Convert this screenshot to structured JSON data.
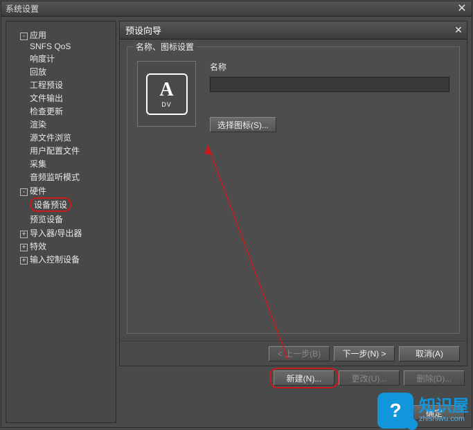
{
  "window_title": "系统设置",
  "tree": {
    "app": {
      "label": "应用",
      "toggle": "-"
    },
    "snfs_qos": "SNFS QoS",
    "loudness": "响度计",
    "playback": "回放",
    "project_preset": "工程预设",
    "file_output": "文件输出",
    "check_update": "检查更新",
    "render": "渲染",
    "source_browse": "源文件浏览",
    "user_config": "用户配置文件",
    "capture": "采集",
    "audio_monitor": "音频监听模式",
    "hardware": {
      "label": "硬件",
      "toggle": "-"
    },
    "device_preset": "设备预设",
    "preview_device": "预览设备",
    "importer": {
      "label": "导入器/导出器",
      "toggle": "+"
    },
    "effects": {
      "label": "特效",
      "toggle": "+"
    },
    "input_ctrl": {
      "label": "输入控制设备",
      "toggle": "+"
    }
  },
  "wizard": {
    "title": "预设向导",
    "group_label": "名称、图标设置",
    "name_label": "名称",
    "name_value": "",
    "icon_letter": "A",
    "icon_sub": "DV",
    "select_icon": "选择图标(S)...",
    "prev": "< 上一步(B)",
    "next": "下一步(N) >",
    "cancel": "取消(A)"
  },
  "toolbar": {
    "new": "新建(N)...",
    "change": "更改(U)...",
    "delete": "删除(D)..."
  },
  "ok_label": "确定",
  "watermark": {
    "zh": "知识屋",
    "en": "zhishiwu.com",
    "badge": "?"
  }
}
